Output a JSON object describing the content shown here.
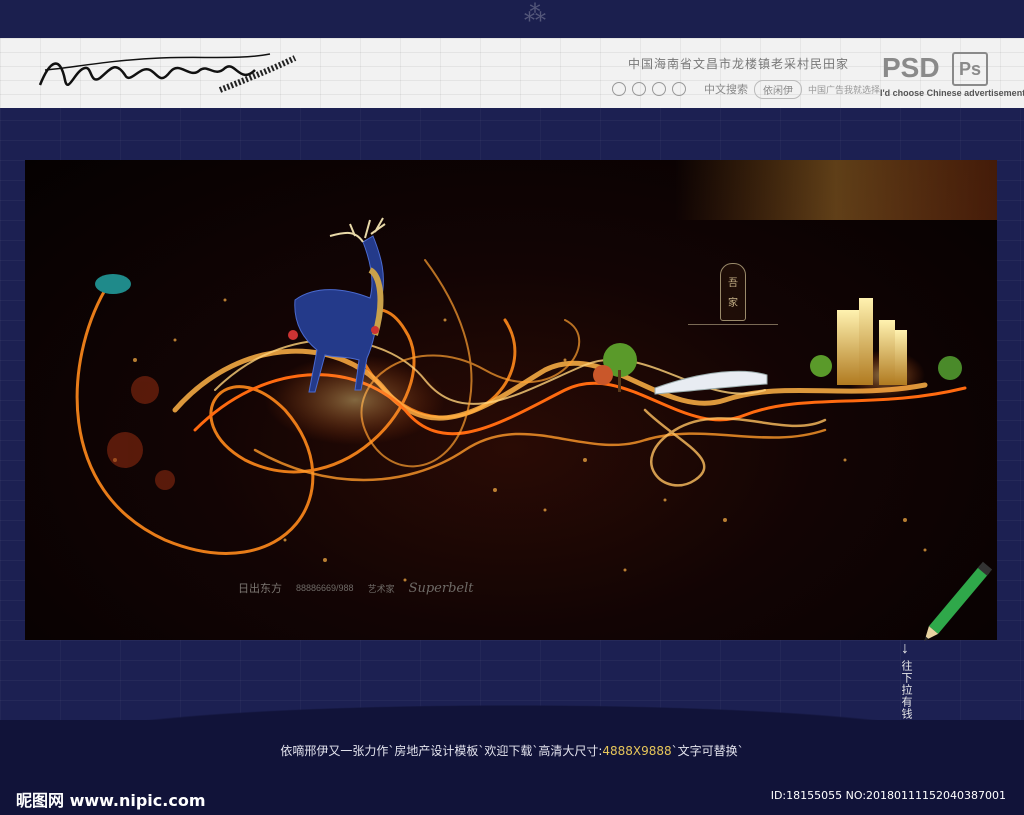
{
  "banner": {
    "signature": "依嘀邢伊",
    "title": "中国海南省文昌市龙楼镇老采村民田家",
    "search_label": "中文搜索",
    "search_button": "依闲伊",
    "small_text": "中国广告我就选择",
    "psd": "PSD",
    "ps": "Ps",
    "english": "I'd choose Chinese advertisement"
  },
  "poster": {
    "emblem": [
      "吾",
      "家"
    ],
    "footer": {
      "brand": "日出东方",
      "phone": "88886669/988",
      "slogan": "艺术家",
      "script": "Superbelt"
    }
  },
  "scroll_hint": "往下拉有钱",
  "caption": {
    "before": "依嘀邢伊又一张力作`房地产设计模板`欢迎下载`高清大尺寸:",
    "size": "4888X9888",
    "after": "`文字可替换`"
  },
  "footer": {
    "logo": "昵图网 www.nipic.com",
    "id": "ID:18155055 NO:20180111152040387001"
  },
  "colors": {
    "background": "#1c2052",
    "banner": "#f2f2f2",
    "fire": "#ff8a1c",
    "highlight": "#e7c65a"
  }
}
